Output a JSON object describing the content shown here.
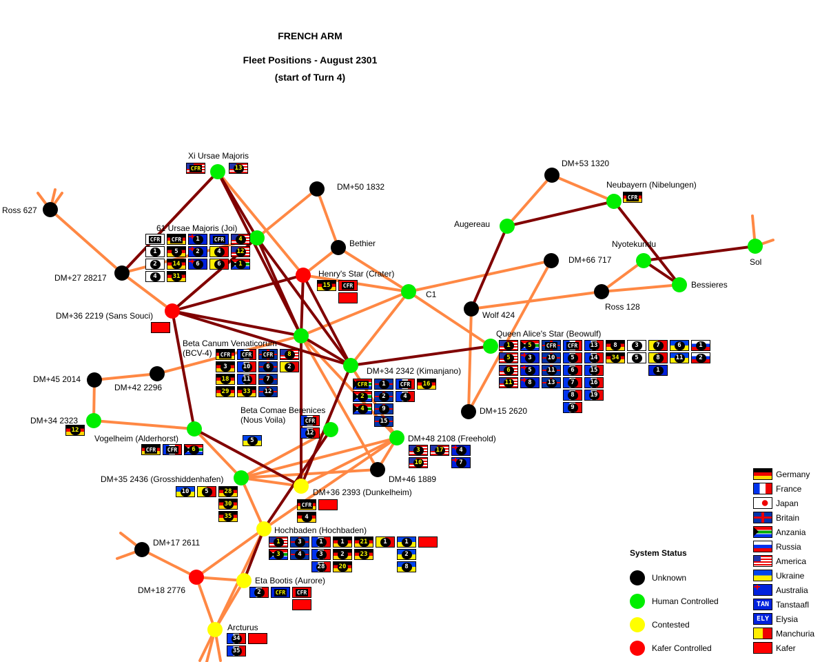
{
  "title": {
    "line1": "FRENCH ARM",
    "line2": "Fleet Positions - August 2301",
    "line3": "(start of Turn 4)"
  },
  "colors": {
    "unknown": "#000000",
    "human": "#00ee00",
    "contested": "#ffff00",
    "kafer": "#ff0000",
    "route_light": "#ff8844",
    "route_dark": "#800000"
  },
  "systems": [
    {
      "id": "xi-uma",
      "name": "Xi Ursae Majoris",
      "status": "human"
    },
    {
      "id": "ross627",
      "name": "Ross 627",
      "status": "unknown"
    },
    {
      "id": "dm50-1832",
      "name": "DM+50 1832",
      "status": "unknown"
    },
    {
      "id": "61uma",
      "name": "61 Ursae Majoris (Joi)",
      "status": "human"
    },
    {
      "id": "bethier",
      "name": "Bethier",
      "status": "unknown"
    },
    {
      "id": "dm27",
      "name": "DM+27 28217",
      "status": "unknown"
    },
    {
      "id": "henry",
      "name": "Henry's Star (Crater)",
      "status": "kafer"
    },
    {
      "id": "sanssouci",
      "name": "DM+36 2219 (Sans Souci)",
      "status": "kafer"
    },
    {
      "id": "c1",
      "name": "C1",
      "status": "human"
    },
    {
      "id": "bcv",
      "name": "Beta Canum Venaticorum (BCV-4)",
      "status": "human"
    },
    {
      "id": "kimanjano",
      "name": "DM+34 2342 (Kimanjano)",
      "status": "human"
    },
    {
      "id": "dm45",
      "name": "DM+45 2014",
      "status": "unknown"
    },
    {
      "id": "dm42",
      "name": "DM+42 2296",
      "status": "unknown"
    },
    {
      "id": "dm34-2323",
      "name": "DM+34 2323",
      "status": "human"
    },
    {
      "id": "vogelheim",
      "name": "Vogelheim (Alderhorst)",
      "status": "human"
    },
    {
      "id": "bcomae",
      "name": "Beta Comae Berenices (Nous Voila)",
      "status": "human"
    },
    {
      "id": "freehold",
      "name": "DM+48 2108 (Freehold)",
      "status": "human"
    },
    {
      "id": "dm46",
      "name": "DM+46 1889",
      "status": "unknown"
    },
    {
      "id": "gross",
      "name": "DM+35 2436 (Grosshiddenhafen)",
      "status": "human"
    },
    {
      "id": "dunkel",
      "name": "DM+36 2393 (Dunkelheim)",
      "status": "contested"
    },
    {
      "id": "hochbaden",
      "name": "Hochbaden (Hochbaden)",
      "status": "contested"
    },
    {
      "id": "dm17",
      "name": "DM+17 2611",
      "status": "unknown"
    },
    {
      "id": "dm18",
      "name": "DM+18 2776",
      "status": "kafer"
    },
    {
      "id": "eta",
      "name": "Eta Bootis (Aurore)",
      "status": "contested"
    },
    {
      "id": "arcturus",
      "name": "Arcturus",
      "status": "contested"
    },
    {
      "id": "dm53",
      "name": "DM+53 1320",
      "status": "unknown"
    },
    {
      "id": "neubayern",
      "name": "Neubayern (Nibelungen)",
      "status": "human"
    },
    {
      "id": "augereau",
      "name": "Augereau",
      "status": "human"
    },
    {
      "id": "dm66",
      "name": "DM+66 717",
      "status": "unknown"
    },
    {
      "id": "nyotekundu",
      "name": "Nyotekundu",
      "status": "human"
    },
    {
      "id": "sol",
      "name": "Sol",
      "status": "human"
    },
    {
      "id": "ross128",
      "name": "Ross 128",
      "status": "unknown"
    },
    {
      "id": "bessieres",
      "name": "Bessieres",
      "status": "human"
    },
    {
      "id": "wolf424",
      "name": "Wolf 424",
      "status": "unknown"
    },
    {
      "id": "qas",
      "name": "Queen Alice's Star (Beowulf)",
      "status": "human"
    },
    {
      "id": "dm15",
      "name": "DM+15 2620",
      "status": "unknown"
    }
  ],
  "fleets": {
    "xi-uma": [
      [
        [
          "america",
          "CFR"
        ],
        null,
        [
          "america",
          "13"
        ]
      ]
    ],
    "61uma": [
      [
        [
          "japan",
          "CFR"
        ],
        [
          "germany",
          "CFR"
        ],
        [
          "australia",
          "1"
        ],
        [
          "elysia",
          "CFR"
        ],
        [
          "america",
          "4"
        ]
      ],
      [
        [
          "japan",
          "1"
        ],
        [
          "germany",
          "5"
        ],
        [
          "australia",
          "2"
        ],
        [
          "manchuria",
          "4"
        ],
        [
          "america",
          "12"
        ]
      ],
      [
        [
          "japan",
          "2"
        ],
        [
          "germany",
          "14"
        ],
        [
          "australia",
          "6"
        ],
        [
          "manchuria",
          "6"
        ],
        [
          "anzania",
          "1"
        ]
      ],
      [
        [
          "japan",
          "4"
        ],
        [
          "germany",
          "31"
        ]
      ]
    ],
    "henry": [
      [
        [
          "germany",
          "15"
        ],
        [
          "kafer",
          "CFR"
        ]
      ],
      [
        null,
        [
          "kafer",
          ""
        ]
      ]
    ],
    "sanssouci": [
      [
        [
          "kafer",
          ""
        ]
      ]
    ],
    "bcv": [
      [
        [
          "germany",
          "CFR"
        ],
        [
          "france",
          "CFR"
        ],
        [
          "britain",
          "CFR"
        ],
        [
          "america",
          "8"
        ]
      ],
      [
        [
          "germany",
          "3"
        ],
        [
          "france",
          "10"
        ],
        [
          "britain",
          "6"
        ],
        [
          "manchuria",
          "2"
        ]
      ],
      [
        [
          "germany",
          "18"
        ],
        [
          "france",
          "11"
        ],
        [
          "britain",
          "7"
        ]
      ],
      [
        [
          "germany",
          "29"
        ],
        [
          "germany",
          "33"
        ],
        [
          "britain",
          "12"
        ]
      ]
    ],
    "kimanjano": [
      [
        [
          "anzania",
          "CFR"
        ],
        [
          "britain",
          "1"
        ],
        [
          "france",
          "CFR"
        ],
        [
          "germany",
          "16"
        ]
      ],
      [
        [
          "anzania",
          "2"
        ],
        [
          "britain",
          "2"
        ],
        [
          "france",
          "4"
        ]
      ],
      [
        [
          "anzania",
          "4"
        ],
        [
          "britain",
          "9"
        ]
      ],
      [
        null,
        [
          "britain",
          "15"
        ]
      ]
    ],
    "qas": [
      [
        [
          "america",
          "1"
        ],
        [
          "anzania",
          "5"
        ],
        [
          "britain",
          "CFR"
        ],
        [
          "france",
          "CFR"
        ],
        [
          "france",
          "13"
        ],
        [
          "germany",
          "8"
        ],
        [
          "japan",
          "3"
        ],
        [
          "manchuria",
          "7"
        ],
        [
          "ukraine",
          "6"
        ],
        [
          "russia",
          "1"
        ]
      ],
      [
        [
          "america",
          "5"
        ],
        [
          "australia",
          "3"
        ],
        [
          "britain",
          "10"
        ],
        [
          "france",
          "5"
        ],
        [
          "france",
          "14"
        ],
        [
          "germany",
          "34"
        ],
        [
          "japan",
          "5"
        ],
        [
          "manchuria",
          "8"
        ],
        [
          "ukraine",
          "11"
        ],
        [
          "russia",
          "2"
        ]
      ],
      [
        [
          "america",
          "6"
        ],
        [
          "australia",
          "5"
        ],
        [
          "britain",
          "11"
        ],
        [
          "france",
          "6"
        ],
        [
          "france",
          "15"
        ],
        null,
        null,
        [
          "elysia",
          "1"
        ]
      ],
      [
        [
          "america",
          "11"
        ],
        [
          "australia",
          "8"
        ],
        [
          "britain",
          "13"
        ],
        [
          "france",
          "7"
        ],
        [
          "france",
          "16"
        ]
      ],
      [
        null,
        null,
        null,
        [
          "france",
          "8"
        ],
        [
          "france",
          "19"
        ]
      ],
      [
        null,
        null,
        null,
        [
          "france",
          "9"
        ]
      ]
    ],
    "dm34-2323": [
      [
        [
          "germany",
          "12"
        ]
      ]
    ],
    "vogelheim": [
      [
        [
          "germany",
          "CFR"
        ],
        [
          "france",
          "CFR"
        ],
        [
          "anzania",
          "6"
        ]
      ]
    ],
    "bcomae-a": [
      [
        [
          "france",
          "CFR"
        ]
      ],
      [
        [
          "france",
          "12"
        ]
      ]
    ],
    "bcomae-b": [
      [
        [
          "ukraine",
          "5"
        ]
      ]
    ],
    "freehold": [
      [
        [
          "america",
          "3"
        ],
        [
          "america",
          "17"
        ],
        [
          "australia",
          "4"
        ]
      ],
      [
        [
          "america",
          "10"
        ],
        null,
        [
          "australia",
          "7"
        ]
      ]
    ],
    "gross": [
      [
        [
          "ukraine",
          "10"
        ],
        [
          "manchuria",
          "5"
        ],
        [
          "germany",
          "28"
        ]
      ],
      [
        null,
        null,
        [
          "germany",
          "30"
        ]
      ],
      [
        null,
        null,
        [
          "germany",
          "35"
        ]
      ]
    ],
    "dunkel": [
      [
        [
          "germany",
          "CFR"
        ],
        [
          "kafer",
          ""
        ]
      ],
      [
        [
          "germany",
          "4"
        ]
      ]
    ],
    "hochbaden": [
      [
        [
          "america",
          "1"
        ],
        [
          "britain",
          "3"
        ],
        [
          "france",
          "1"
        ],
        [
          "germany",
          "1"
        ],
        [
          "germany",
          "21"
        ],
        [
          "manchuria",
          "1"
        ],
        [
          "ukraine",
          "1"
        ],
        [
          "kafer",
          ""
        ]
      ],
      [
        [
          "anzania",
          "3"
        ],
        [
          "britain",
          "4"
        ],
        [
          "france",
          "3"
        ],
        [
          "germany",
          "2"
        ],
        [
          "germany",
          "23"
        ],
        null,
        [
          "ukraine",
          "2"
        ]
      ],
      [
        null,
        null,
        [
          "france",
          "28"
        ],
        [
          "germany",
          "20"
        ],
        null,
        null,
        [
          "ukraine",
          "8"
        ]
      ]
    ],
    "eta": [
      [
        [
          "france",
          "2"
        ],
        [
          "tanstaafl",
          "CFR"
        ],
        [
          "kafer",
          "CFR"
        ]
      ],
      [
        null,
        null,
        [
          "kafer",
          ""
        ]
      ]
    ],
    "arcturus": [
      [
        [
          "france",
          "34"
        ],
        [
          "kafer",
          ""
        ]
      ],
      [
        [
          "france",
          "35"
        ]
      ]
    ],
    "neubayern": [
      [
        [
          "germany",
          "CFR"
        ]
      ]
    ]
  },
  "legend_status": {
    "title": "System Status",
    "items": [
      {
        "key": "unknown",
        "label": "Unknown"
      },
      {
        "key": "human",
        "label": "Human Controlled"
      },
      {
        "key": "contested",
        "label": "Contested"
      },
      {
        "key": "kafer",
        "label": "Kafer Controlled"
      }
    ]
  },
  "legend_flags": [
    {
      "key": "germany",
      "label": "Germany"
    },
    {
      "key": "france",
      "label": "France"
    },
    {
      "key": "japan",
      "label": "Japan"
    },
    {
      "key": "britain",
      "label": "Britain"
    },
    {
      "key": "anzania",
      "label": "Anzania"
    },
    {
      "key": "russia",
      "label": "Russia"
    },
    {
      "key": "america",
      "label": "America"
    },
    {
      "key": "ukraine",
      "label": "Ukraine"
    },
    {
      "key": "australia",
      "label": "Australia"
    },
    {
      "key": "tanstaafl",
      "label": "Tanstaafl",
      "text": "TAN"
    },
    {
      "key": "elysia",
      "label": "Elysia",
      "text": "ELY"
    },
    {
      "key": "manchuria",
      "label": "Manchuria"
    },
    {
      "key": "kafer",
      "label": "Kafer"
    }
  ]
}
